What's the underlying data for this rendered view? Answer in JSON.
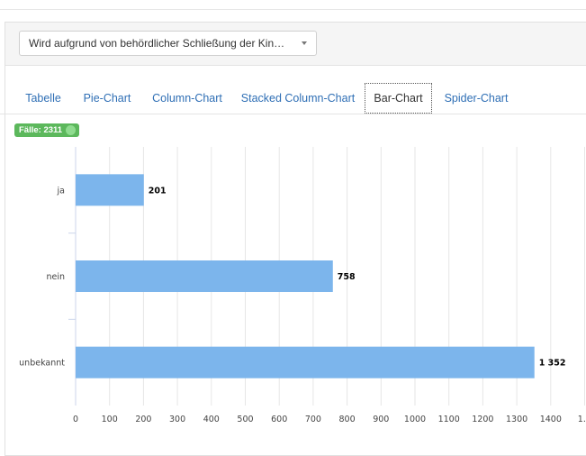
{
  "filter": {
    "selected": "Wird aufgrund von behördlicher Schließung der Kinde…"
  },
  "tabs": [
    {
      "label": "Tabelle",
      "active": false
    },
    {
      "label": "Pie-Chart",
      "active": false
    },
    {
      "label": "Column-Chart",
      "active": false
    },
    {
      "label": "Stacked Column-Chart",
      "active": false
    },
    {
      "label": "Bar-Chart",
      "active": true
    },
    {
      "label": "Spider-Chart",
      "active": false
    }
  ],
  "badge": {
    "label": "Fälle: 2311"
  },
  "colors": {
    "bar": "#7cb5ec",
    "badge": "#5cb85c",
    "link": "#2f6fb5"
  },
  "chart_data": {
    "type": "bar",
    "orientation": "horizontal",
    "categories": [
      "ja",
      "nein",
      "unbekannt"
    ],
    "values": [
      201,
      758,
      1352
    ],
    "value_labels": [
      "201",
      "758",
      "1 352"
    ],
    "xlim": [
      0,
      1500
    ],
    "x_ticks": [
      "0",
      "100",
      "200",
      "300",
      "400",
      "500",
      "600",
      "700",
      "800",
      "900",
      "1000",
      "1100",
      "1200",
      "1300",
      "1400",
      "1…"
    ],
    "grid": true,
    "legend": false
  }
}
